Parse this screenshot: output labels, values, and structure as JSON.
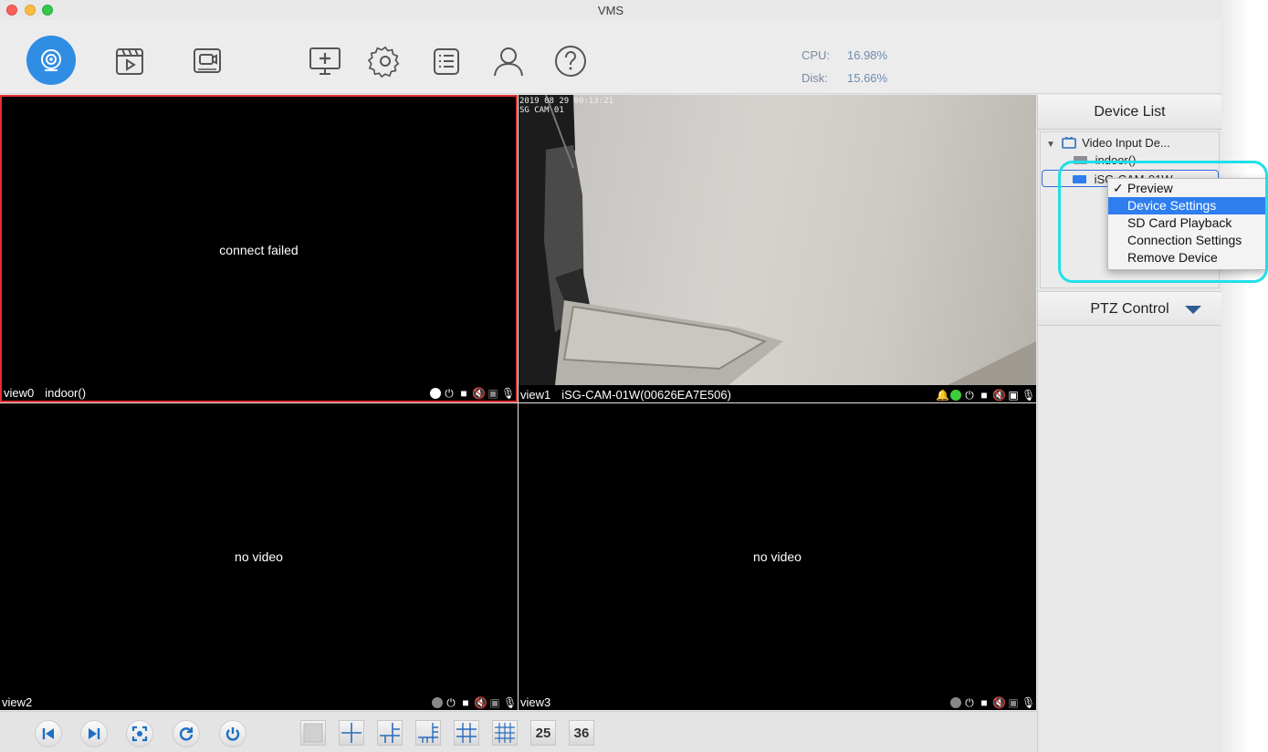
{
  "window": {
    "title": "VMS"
  },
  "toolbar": {
    "icons": [
      "live-view-icon",
      "playback-icon",
      "recorder-icon",
      "add-device-icon",
      "settings-icon",
      "log-icon",
      "user-icon",
      "help-icon"
    ],
    "cpu_label": "CPU:",
    "cpu_value": "16.98%",
    "disk_label": "Disk:",
    "disk_value": "15.66%"
  },
  "views": [
    {
      "id": "view0",
      "device": "indoor()",
      "message": "connect failed"
    },
    {
      "id": "view1",
      "device": "iSG-CAM-01W(00626EA7E506)",
      "osd_time": "2019 08 29 00:13:21",
      "osd_name": " SG CAM 01"
    },
    {
      "id": "view2",
      "device": "",
      "message": "no video"
    },
    {
      "id": "view3",
      "device": "",
      "message": "no video"
    }
  ],
  "device_list": {
    "title": "Device List",
    "root": "Video Input De...",
    "items": [
      "indoor()",
      "iSG-CAM-01W"
    ]
  },
  "context_menu": {
    "items": [
      {
        "label": "Preview",
        "checked": true
      },
      {
        "label": "Device Settings",
        "selected": true
      },
      {
        "label": "SD Card Playback"
      },
      {
        "label": "Connection Settings"
      },
      {
        "label": "Remove Device"
      }
    ]
  },
  "ptz": {
    "title": "PTZ Control"
  },
  "bottombar": {
    "layout_25": "25",
    "layout_36": "36"
  },
  "colors": {
    "accent": "#2f8de4",
    "active_border": "#e53030",
    "highlight": "#1fe0e8",
    "menu_selected": "#2e7ef0"
  }
}
